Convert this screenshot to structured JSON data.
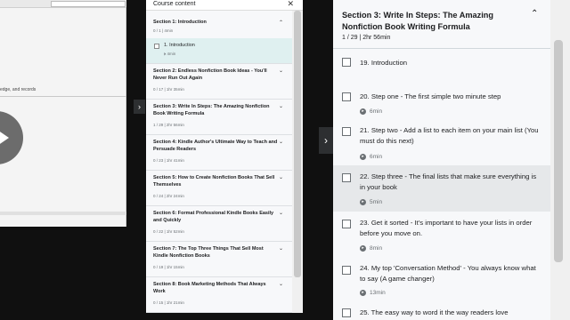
{
  "left_panel": {
    "snippet": "edge, and records"
  },
  "small_sidebar": {
    "title": "Course content",
    "close": "✕",
    "toggle": "›",
    "sections": [
      {
        "title": "Section 1: Introduction",
        "meta": "0 / 1 | 4min",
        "expanded": true
      },
      {
        "title": "Section 2: Endless Nonfiction Book Ideas - You'll Never Run Out Again",
        "meta": "0 / 17 | 1hr 35min"
      },
      {
        "title": "Section 3: Write In Steps: The Amazing Nonfiction Book Writing Formula",
        "meta": "1 / 29 | 2hr 56min"
      },
      {
        "title": "Section 4: Kindle Author's Ultimate Way to Teach and Persuade Readers",
        "meta": "0 / 23 | 1hr 41min"
      },
      {
        "title": "Section 5: How to Create Nonfiction Books That Sell Themselves",
        "meta": "0 / 24 | 2hr 24min"
      },
      {
        "title": "Section 6: Format Professional Kindle Books Easily and Quickly",
        "meta": "0 / 22 | 1hr 52min"
      },
      {
        "title": "Section 7: The Top Three Things That Sell Most Kindle Nonfiction Books",
        "meta": "0 / 19 | 1hr 15min"
      },
      {
        "title": "Section 8: Book Marketing Methods That Always Work",
        "meta": "0 / 15 | 1hr 21min"
      }
    ],
    "active_item": {
      "title": "1. Introduction",
      "duration": "4min"
    }
  },
  "main_sidebar": {
    "toggle": "›",
    "section_title": "Section 3: Write In Steps: The Amazing Nonfiction Book Writing Formula",
    "section_meta": "1 / 29 | 2hr 56min",
    "chevron": "⌃",
    "lectures": [
      {
        "title": "19. Introduction",
        "duration": ""
      },
      {
        "title": "20. Step one - The first simple two minute step",
        "duration": "6min"
      },
      {
        "title": "21. Step two - Add a list to each item on your main list (You must do this next)",
        "duration": "6min"
      },
      {
        "title": "22. Step three - The final lists that make sure everything is in your book",
        "duration": "5min"
      },
      {
        "title": "23. Get it sorted - It's important to have your lists in order before you move on.",
        "duration": "8min"
      },
      {
        "title": "24. My top 'Conversation Method' - You always know what to say (A game changer)",
        "duration": "13min"
      },
      {
        "title": "25. The easy way to word it the way readers love",
        "duration": ""
      }
    ]
  },
  "colors": {
    "background": "#101010",
    "sidebar_bg": "#f7f8fa",
    "active_item_bg": "#dff0f0",
    "text": "#1c1d1f",
    "muted": "#6a6f73"
  }
}
